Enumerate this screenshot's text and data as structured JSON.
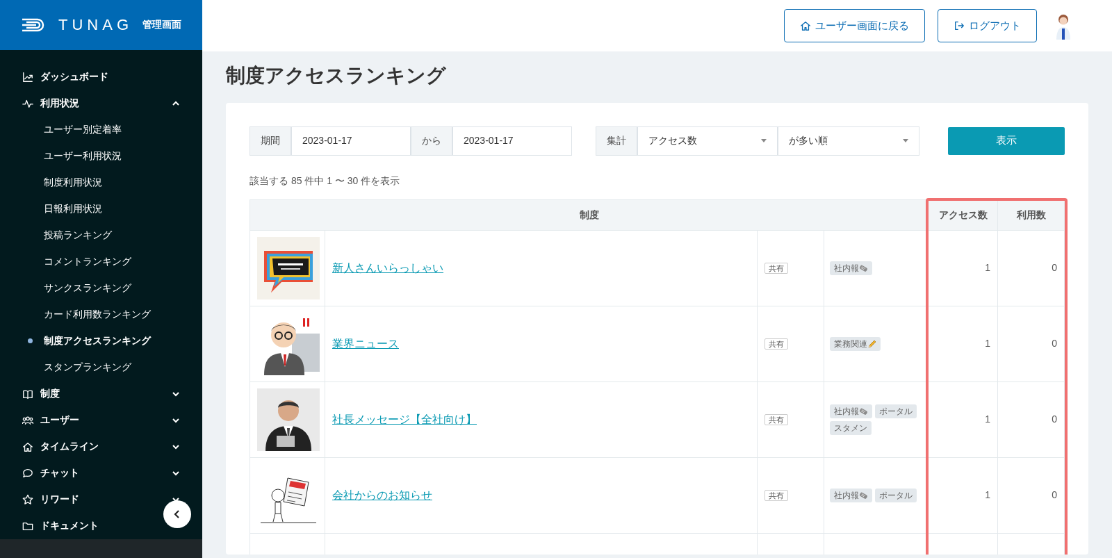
{
  "brand": {
    "logo": "TUNAG",
    "subtitle": "管理画面"
  },
  "sidebar": {
    "items": [
      {
        "label": "ダッシュボード"
      },
      {
        "label": "利用状況",
        "expanded": true,
        "children": [
          {
            "label": "ユーザー別定着率",
            "selected": false
          },
          {
            "label": "ユーザー利用状況",
            "selected": false
          },
          {
            "label": "制度利用状況",
            "selected": false
          },
          {
            "label": "日報利用状況",
            "selected": false
          },
          {
            "label": "投稿ランキング",
            "selected": false
          },
          {
            "label": "コメントランキング",
            "selected": false
          },
          {
            "label": "サンクスランキング",
            "selected": false
          },
          {
            "label": "カード利用数ランキング",
            "selected": false
          },
          {
            "label": "制度アクセスランキング",
            "selected": true
          },
          {
            "label": "スタンプランキング",
            "selected": false
          }
        ]
      },
      {
        "label": "制度",
        "expanded": false
      },
      {
        "label": "ユーザー",
        "expanded": false
      },
      {
        "label": "タイムライン",
        "expanded": false
      },
      {
        "label": "チャット",
        "expanded": false
      },
      {
        "label": "リワード",
        "expanded": false
      },
      {
        "label": "ドキュメント"
      }
    ]
  },
  "header": {
    "buttons": [
      {
        "label": "ユーザー画面に戻る"
      },
      {
        "label": "ログアウト"
      }
    ]
  },
  "page_title": "制度アクセスランキング",
  "filters": {
    "period_label": "期間",
    "from_date": "2023-01-17",
    "from_word": "から",
    "to_date": "2023-01-17",
    "aggregate_label": "集計",
    "metric": "アクセス数",
    "order": "が多い順",
    "submit": "表示"
  },
  "result_summary": "該当する 85 件中 1 〜 30 件を表示",
  "table": {
    "columns": [
      "制度",
      "アクセス数",
      "利用数"
    ],
    "rows": [
      {
        "name": "新人さんいらっしゃい",
        "scope": "共有",
        "tags": [
          {
            "label": "社内報",
            "kind": "newspaper"
          }
        ],
        "access": "1",
        "usage": "0"
      },
      {
        "name": "業界ニュース",
        "scope": "共有",
        "tags": [
          {
            "label": "業務関連",
            "kind": "pencil"
          }
        ],
        "access": "1",
        "usage": "0"
      },
      {
        "name": "社長メッセージ【全社向け】",
        "scope": "共有",
        "tags": [
          {
            "label": "社内報",
            "kind": "newspaper"
          },
          {
            "label": "ポータル",
            "kind": "plain"
          },
          {
            "label": "スタメン",
            "kind": "plain"
          }
        ],
        "access": "1",
        "usage": "0"
      },
      {
        "name": "会社からのお知らせ",
        "scope": "共有",
        "tags": [
          {
            "label": "社内報",
            "kind": "newspaper"
          },
          {
            "label": "ポータル",
            "kind": "plain"
          }
        ],
        "access": "1",
        "usage": "0"
      }
    ]
  }
}
